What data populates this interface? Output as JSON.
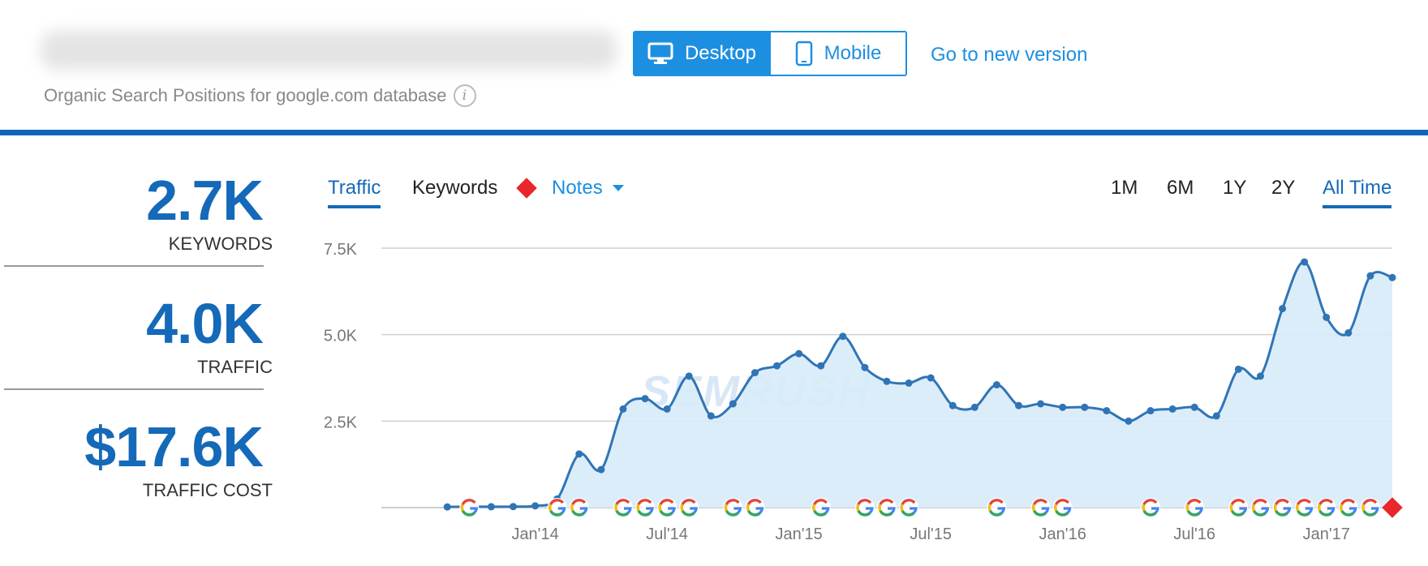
{
  "header": {
    "subtitle": "Organic Search Positions for google.com database",
    "info_icon": "info-icon",
    "device": {
      "desktop_label": "Desktop",
      "mobile_label": "Mobile",
      "selected": "Desktop"
    },
    "new_version_link": "Go to new version"
  },
  "metrics": [
    {
      "value": "2.7K",
      "label": "KEYWORDS"
    },
    {
      "value": "4.0K",
      "label": "TRAFFIC"
    },
    {
      "value": "$17.6K",
      "label": "TRAFFIC COST"
    }
  ],
  "tabs": {
    "traffic": "Traffic",
    "keywords": "Keywords",
    "notes": "Notes",
    "selected": "Traffic"
  },
  "ranges": {
    "m1": "1M",
    "m6": "6M",
    "y1": "1Y",
    "y2": "2Y",
    "all": "All Time",
    "selected": "All Time"
  },
  "watermark": "SEMRUSH",
  "colors": {
    "accent": "#1d8fe1",
    "line": "#2f75b5",
    "area": "#d8ebfa",
    "note": "#e8262b"
  },
  "chart_data": {
    "type": "area",
    "x_unit": "month",
    "x": [
      "2013-09",
      "2013-10",
      "2013-11",
      "2013-12",
      "2014-01",
      "2014-02",
      "2014-03",
      "2014-04",
      "2014-05",
      "2014-06",
      "2014-07",
      "2014-08",
      "2014-09",
      "2014-10",
      "2014-11",
      "2014-12",
      "2015-01",
      "2015-02",
      "2015-03",
      "2015-04",
      "2015-05",
      "2015-06",
      "2015-07",
      "2015-08",
      "2015-09",
      "2015-10",
      "2015-11",
      "2015-12",
      "2016-01",
      "2016-02",
      "2016-03",
      "2016-04",
      "2016-05",
      "2016-06",
      "2016-07",
      "2016-08",
      "2016-09",
      "2016-10",
      "2016-11",
      "2016-12",
      "2017-01",
      "2017-02",
      "2017-03",
      "2017-04"
    ],
    "values": [
      20,
      30,
      25,
      30,
      50,
      250,
      1550,
      1100,
      2850,
      3150,
      2850,
      3800,
      2650,
      3000,
      3900,
      4100,
      4450,
      4100,
      4950,
      4050,
      3650,
      3600,
      3750,
      2950,
      2900,
      3550,
      2950,
      3000,
      2900,
      2900,
      2800,
      2500,
      2800,
      2850,
      2900,
      2650,
      4000,
      3800,
      5750,
      7100,
      5500,
      5050,
      6700,
      6650
    ],
    "xtick_labels": [
      "Jan'14",
      "Jul'14",
      "Jan'15",
      "Jul'15",
      "Jan'16",
      "Jul'16",
      "Jan'17"
    ],
    "xtick_values": [
      "2014-01",
      "2014-07",
      "2015-01",
      "2015-07",
      "2016-01",
      "2016-07",
      "2017-01"
    ],
    "ytick_labels": [
      "2.5K",
      "5.0K",
      "7.5K"
    ],
    "yticks": [
      2500,
      5000,
      7500
    ],
    "ylim": [
      0,
      7500
    ],
    "google_update_markers": [
      "2013-10",
      "2014-02",
      "2014-03",
      "2014-05",
      "2014-06",
      "2014-07",
      "2014-08",
      "2014-10",
      "2014-11",
      "2015-02",
      "2015-04",
      "2015-05",
      "2015-06",
      "2015-10",
      "2015-12",
      "2016-01",
      "2016-05",
      "2016-07",
      "2016-09",
      "2016-10",
      "2016-11",
      "2016-12",
      "2017-01",
      "2017-02",
      "2017-03"
    ],
    "note_markers": [
      "2017-04"
    ],
    "grid": true
  }
}
